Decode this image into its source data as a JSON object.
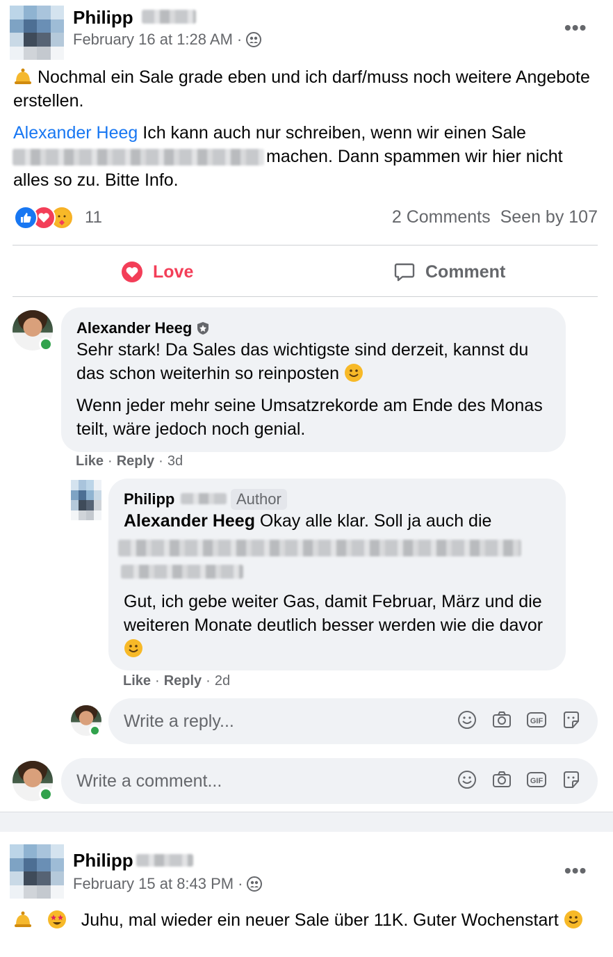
{
  "post1": {
    "author": "Philipp",
    "timestamp": "February 16 at 1:28 AM",
    "privacy_icon": "group-icon",
    "more_label": "•••",
    "text1": "Nochmal ein Sale grade eben und ich darf/muss noch weitere Angebote erstellen.",
    "mention": "Alexander Heeg",
    "text2a": " Ich kann auch nur schreiben, wenn wir einen Sale",
    "text2b": "machen. Dann spammen wir hier nicht alles so zu. Bitte Info.",
    "reaction_count": "11",
    "comments_label": "2 Comments",
    "seen_label": "Seen by 107",
    "love_label": "Love",
    "comment_label": "Comment"
  },
  "comment1": {
    "author": "Alexander Heeg",
    "text1": "Sehr stark! Da Sales das wichtigste sind derzeit, kannst du das schon weiterhin so reinposten",
    "text2": "Wenn jeder mehr seine Umsatzrekorde am Ende des Monas teilt, wäre jedoch noch genial.",
    "like": "Like",
    "reply": "Reply",
    "age": "3d"
  },
  "reply1": {
    "author": "Philipp",
    "badge": "Author",
    "mention": "Alexander Heeg",
    "text1": " Okay alle klar. Soll ja auch die",
    "text2": "Gut, ich gebe weiter Gas, damit Februar, März und die weiteren Monate deutlich besser werden wie die davor",
    "like": "Like",
    "reply": "Reply",
    "age": "2d"
  },
  "reply_input": {
    "placeholder": "Write a reply..."
  },
  "comment_input": {
    "placeholder": "Write a comment..."
  },
  "post2": {
    "author": "Philipp",
    "timestamp": "February 15 at 8:43 PM",
    "more_label": "•••",
    "text": "Juhu, mal wieder ein neuer Sale über 11K. Guter Wochenstart"
  },
  "colors": {
    "love": "#f33e58",
    "link": "#1877f2",
    "online": "#31a24c"
  }
}
